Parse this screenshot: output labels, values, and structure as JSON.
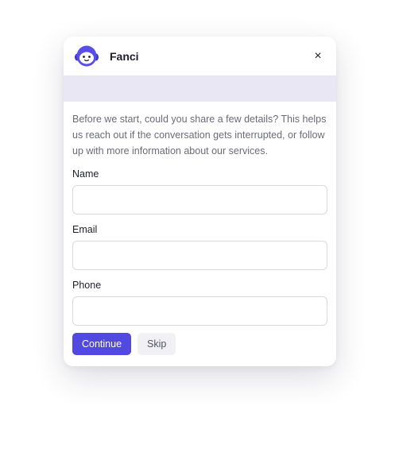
{
  "widget": {
    "brand_name": "Fanci",
    "avatar_icon": "smiling-robot-icon",
    "close_icon": "close-icon",
    "close_glyph": "×"
  },
  "form": {
    "intro": "Before we start, could you share a few details? This helps us reach out if the conversation gets interrupted, or follow up with more information about our services.",
    "fields": [
      {
        "label": "Name",
        "value": "",
        "placeholder": ""
      },
      {
        "label": "Email",
        "value": "",
        "placeholder": ""
      },
      {
        "label": "Phone",
        "value": "",
        "placeholder": ""
      }
    ],
    "continue_label": "Continue",
    "skip_label": "Skip"
  },
  "colors": {
    "accent": "#5149e0",
    "band": "#e8e7f3",
    "avatar_body": "#5a4ee8"
  }
}
